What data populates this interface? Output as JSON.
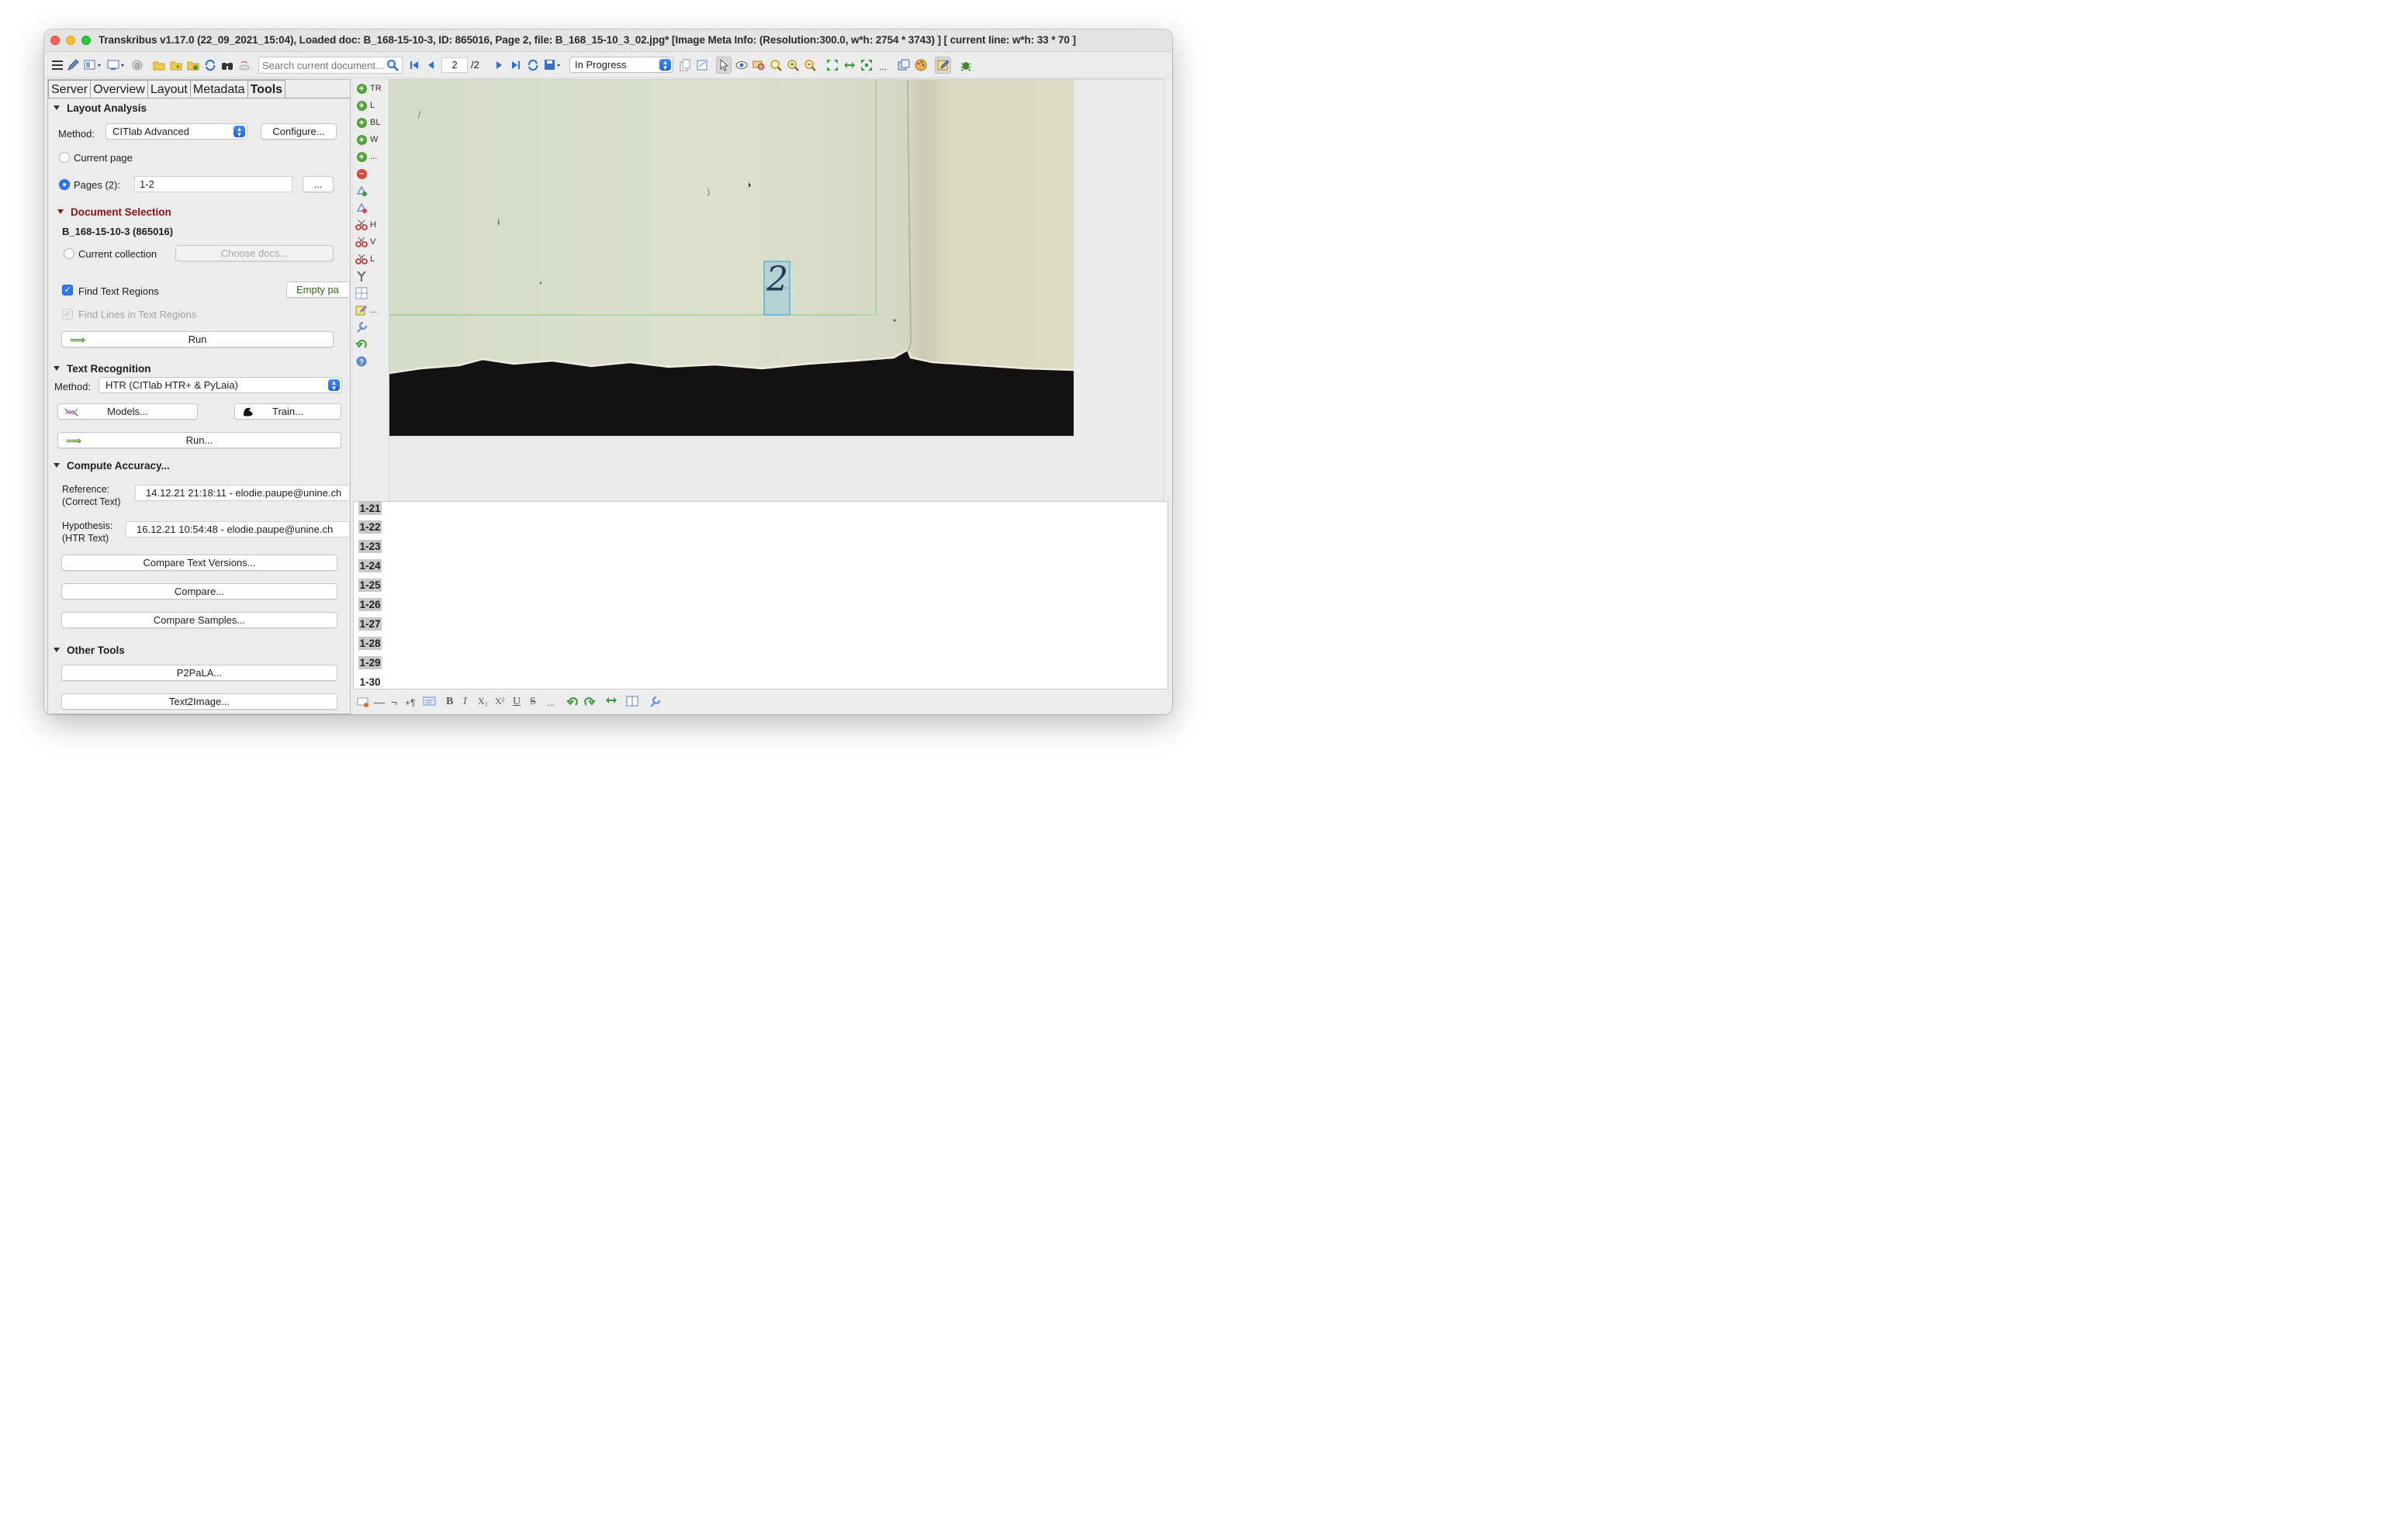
{
  "window": {
    "title": "Transkribus v1.17.0 (22_09_2021_15:04), Loaded doc: B_168-15-10-3, ID: 865016, Page 2, file: B_168_15-10_3_02.jpg* [Image Meta Info: (Resolution:300.0, w*h: 2754 * 3743) ] [ current line: w*h: 33 * 70 ]"
  },
  "toolbar": {
    "search_placeholder": "Search current document...",
    "page_current": "2",
    "page_total": "/2",
    "status": "In Progress",
    "more": "..."
  },
  "tabs": [
    "Server",
    "Overview",
    "Layout",
    "Metadata",
    "Tools"
  ],
  "layout_analysis": {
    "heading": "Layout Analysis",
    "method_label": "Method:",
    "method_value": "CITlab Advanced",
    "configure": "Configure...",
    "current_page": "Current page",
    "pages_label": "Pages (2):",
    "pages_value": "1-2",
    "pages_more": "...",
    "doc_selection_heading": "Document Selection",
    "doc_name": "B_168-15-10-3 (865016)",
    "current_collection": "Current collection",
    "choose_docs": "Choose docs...",
    "find_text_regions": "Find Text Regions",
    "empty_page": "Empty pa",
    "find_lines": "Find Lines in Text Regions",
    "run": "Run"
  },
  "text_recognition": {
    "heading": "Text Recognition",
    "method_label": "Method:",
    "method_value": "HTR (CITlab HTR+ & PyLaia)",
    "models": "Models...",
    "train": "Train...",
    "run": "Run..."
  },
  "compute_accuracy": {
    "heading": "Compute Accuracy...",
    "reference_label": "Reference:",
    "reference_sub": "(Correct Text)",
    "reference_value": "14.12.21 21:18:11 - elodie.paupe@unine.ch",
    "hypothesis_label": "Hypothesis:",
    "hypothesis_sub": "(HTR Text)",
    "hypothesis_value": "16.12.21 10:54:48 - elodie.paupe@unine.ch",
    "compare_versions": "Compare Text Versions...",
    "compare": "Compare...",
    "compare_samples": "Compare Samples..."
  },
  "other_tools": {
    "heading": "Other Tools",
    "p2pala": "P2PaLA...",
    "text2image": "Text2Image..."
  },
  "vertical_tools": [
    {
      "label": "TR",
      "icon": "plus-icon"
    },
    {
      "label": "L",
      "icon": "plus-icon"
    },
    {
      "label": "BL",
      "icon": "plus-icon"
    },
    {
      "label": "W",
      "icon": "plus-icon"
    },
    {
      "label": "...",
      "icon": "plus-icon"
    },
    {
      "label": "",
      "icon": "minus-icon"
    },
    {
      "label": "",
      "icon": "shape-add-icon"
    },
    {
      "label": "",
      "icon": "shape-remove-icon"
    },
    {
      "label": "H",
      "icon": "scissors-icon"
    },
    {
      "label": "V",
      "icon": "scissors-icon"
    },
    {
      "label": "L",
      "icon": "scissors-icon"
    },
    {
      "label": "",
      "icon": "merge-icon"
    },
    {
      "label": "",
      "icon": "table-icon"
    },
    {
      "label": "...",
      "icon": "edit-icon"
    },
    {
      "label": "",
      "icon": "wrench-icon"
    },
    {
      "label": "",
      "icon": "undo-icon"
    },
    {
      "label": "",
      "icon": "help-icon"
    }
  ],
  "canvas": {
    "page_mark": "2"
  },
  "editor": {
    "lines": [
      "1-21",
      "1-22",
      "1-23",
      "1-24",
      "1-25",
      "1-26",
      "1-27",
      "1-28",
      "1-29",
      "1-30"
    ]
  },
  "bottom_toolbar": {
    "dash": "—",
    "not": "¬",
    "pilcrow": "+¶",
    "bold": "B",
    "italic": "I",
    "subscript": "X₂",
    "superscript": "X²",
    "underline": "U",
    "strike": "S",
    "more": "..."
  }
}
